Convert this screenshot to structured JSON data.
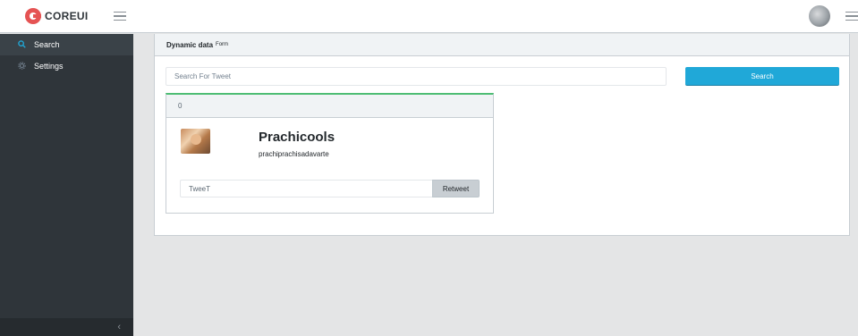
{
  "header": {
    "brand": "COREUI"
  },
  "sidebar": {
    "items": [
      {
        "label": "Search",
        "icon": "search-icon"
      },
      {
        "label": "Settings",
        "icon": "gear-icon"
      }
    ]
  },
  "card": {
    "title": "Dynamic data",
    "subtitle": "Form"
  },
  "search": {
    "placeholder": "Search For Tweet",
    "value": "",
    "button_label": "Search"
  },
  "tweet": {
    "header_count": "0",
    "user_name": "Prachicools",
    "user_handle": "prachiprachisadavarte",
    "input_value": "TweeT",
    "retweet_label": "Retweet"
  },
  "colors": {
    "primary": "#20a8d8",
    "sidebar": "#2f353a",
    "success_accent": "#4dbd74",
    "brand": "#e55353"
  }
}
